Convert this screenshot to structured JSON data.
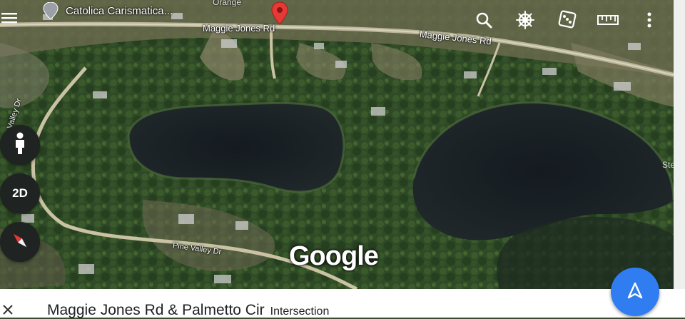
{
  "map": {
    "place_search_label": "Catolica Carismatica...",
    "road_labels": [
      "Orange",
      "Maggie Jones Rd",
      "Maggie Jones Rd",
      "Pine Valley Dr",
      "Pine Valley Dr",
      "Stella"
    ],
    "provider_logo": "Google"
  },
  "topbar": {
    "icons": [
      "menu-icon",
      "search-icon",
      "ships-wheel-icon",
      "dice-icon",
      "ruler-icon",
      "more-vert-icon"
    ]
  },
  "side_controls": {
    "view_mode_label": "2D",
    "icons": [
      "pegman-icon",
      "compass-icon"
    ]
  },
  "bottom_sheet": {
    "title": "Maggie Jones Rd & Palmetto Cir",
    "subtitle": "Intersection"
  },
  "colors": {
    "accent": "#2f7df0",
    "marker": "#e53935",
    "compass_north": "#e53935"
  }
}
